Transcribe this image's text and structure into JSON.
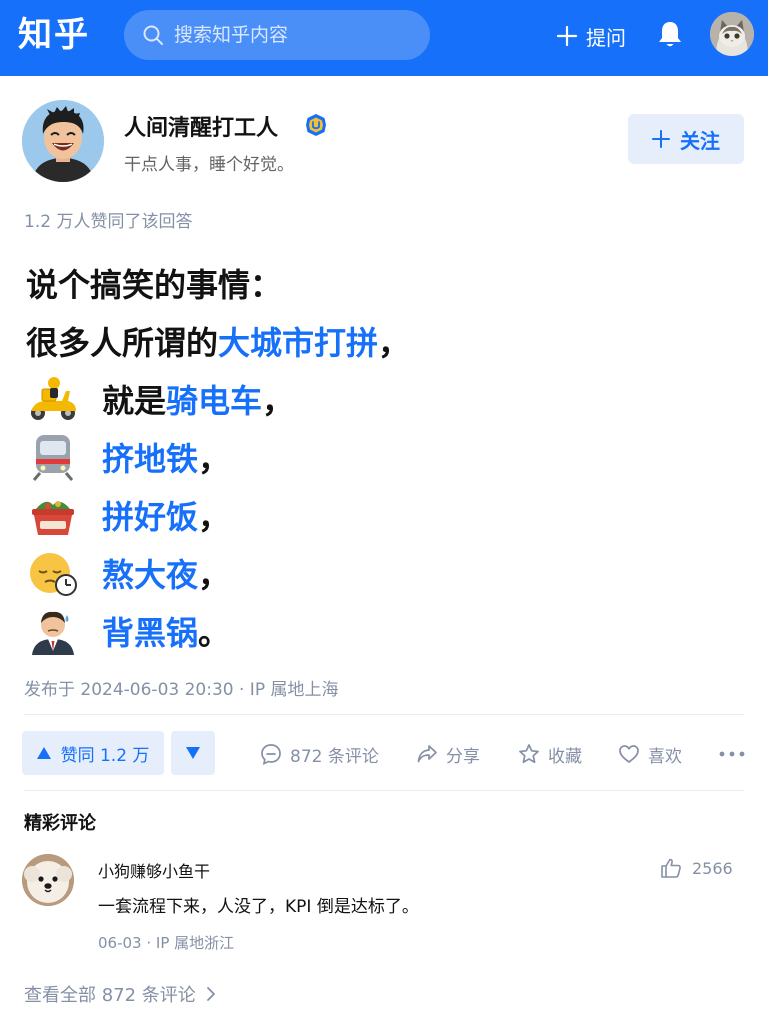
{
  "header": {
    "logo": "知乎",
    "search_placeholder": "搜索知乎内容",
    "ask_label": "提问",
    "icons": [
      "search-icon",
      "plus-icon",
      "bell-icon",
      "cat-avatar"
    ]
  },
  "author": {
    "name": "人间清醒打工人",
    "bio": "干点人事，睡个好觉。",
    "follow_label": "关注"
  },
  "agree_note": "1.2 万人赞同了该回答",
  "answer": {
    "line1": "说个搞笑的事情：",
    "line2_prefix": "很多人所谓的",
    "line2_highlight": "大城市打拼",
    "line2_suffix": "，",
    "items": [
      {
        "emoji": "delivery-scooter-icon",
        "prefix": "就是",
        "highlight": "骑电车",
        "suffix": "，"
      },
      {
        "emoji": "subway-train-icon",
        "prefix": "",
        "highlight": "挤地铁",
        "suffix": "，"
      },
      {
        "emoji": "takeout-box-icon",
        "prefix": "",
        "highlight": "拼好饭",
        "suffix": "，"
      },
      {
        "emoji": "sleepy-face-clock-icon",
        "prefix": "",
        "highlight": "熬大夜",
        "suffix": "，"
      },
      {
        "emoji": "sweating-businessman-icon",
        "prefix": "",
        "highlight": "背黑锅",
        "suffix": "。"
      }
    ]
  },
  "publish_info": "发布于 2024-06-03 20:30 · IP 属地上海",
  "actions": {
    "upvote_label": "赞同 1.2 万",
    "comment_label": "872 条评论",
    "share_label": "分享",
    "collect_label": "收藏",
    "like_label": "喜欢"
  },
  "comments": {
    "section_title": "精彩评论",
    "items": [
      {
        "user": "小狗赚够小鱼干",
        "text": "一套流程下来，人没了，KPI 倒是达标了。",
        "meta": "06-03 · IP 属地浙江",
        "likes": "2566"
      }
    ],
    "view_all_label": "查看全部 872 条评论"
  },
  "colors": {
    "brand_blue": "#1670fa",
    "muted_gray": "#8590a6",
    "light_blue_bg": "#e6eefc"
  }
}
